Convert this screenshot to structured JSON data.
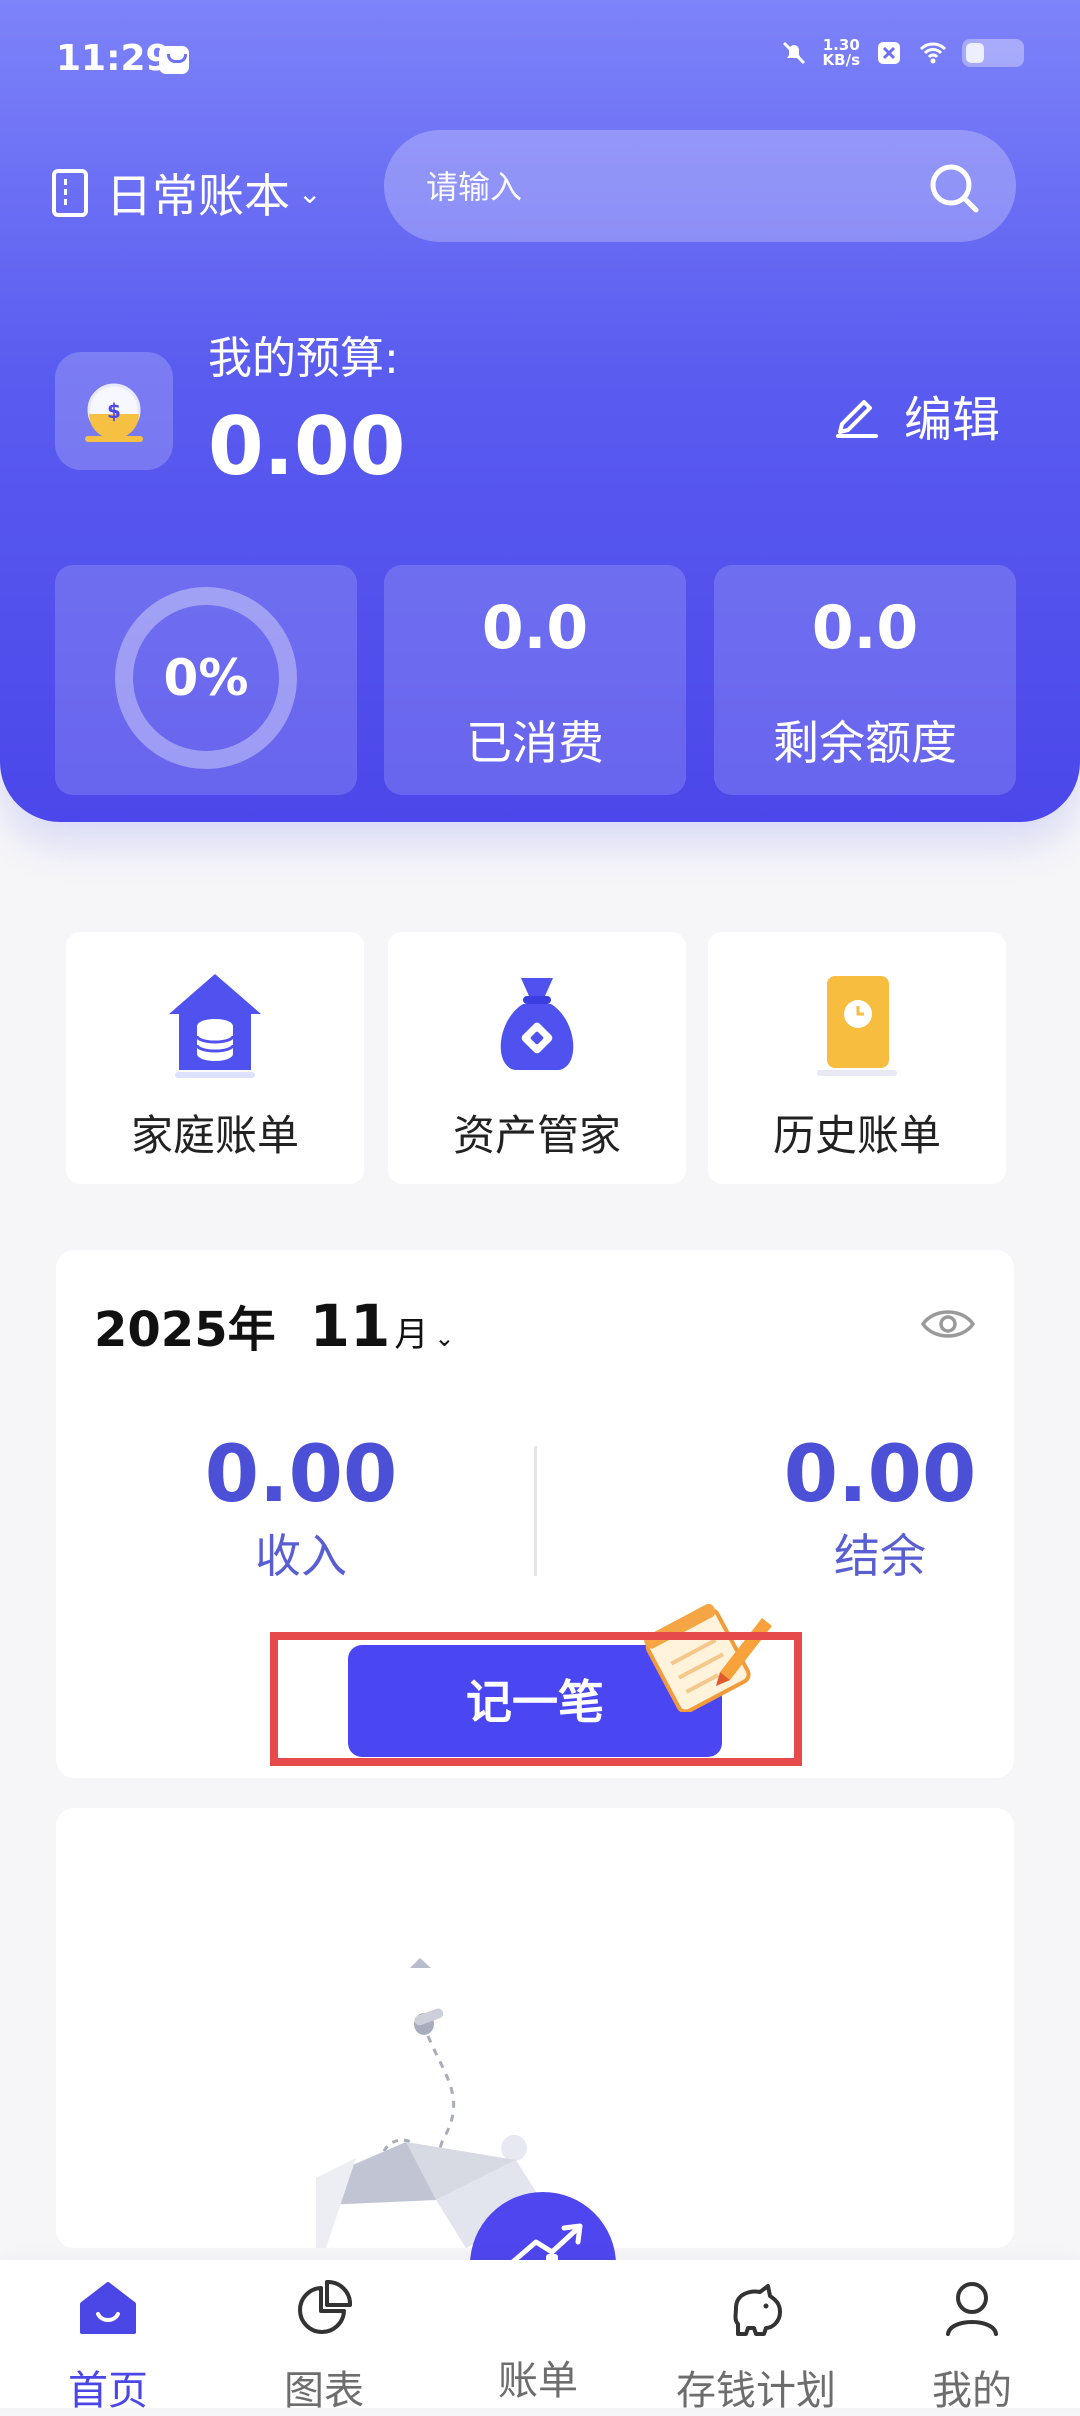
{
  "status_bar": {
    "time": "11:29",
    "net_speed_value": "1.30",
    "net_speed_unit": "KB/s"
  },
  "header": {
    "book_title": "日常账本",
    "search_placeholder": "请输入",
    "budget_label": "我的预算:",
    "budget_value": "0.00",
    "edit_label": "编辑",
    "progress_percent": "0%",
    "spent_value": "0.0",
    "spent_label": "已消费",
    "remaining_value": "0.0",
    "remaining_label": "剩余额度"
  },
  "shortcuts": [
    {
      "label": "家庭账单",
      "icon": "house-coins-icon"
    },
    {
      "label": "资产管家",
      "icon": "money-bag-icon"
    },
    {
      "label": "历史账单",
      "icon": "clock-card-icon"
    }
  ],
  "month_card": {
    "year": "2025年",
    "month": "11",
    "month_unit": "月",
    "income_value": "0.00",
    "income_label": "收入",
    "balance_value": "0.00",
    "balance_label": "结余",
    "record_button": "记一笔"
  },
  "tabs": [
    {
      "label": "首页",
      "icon": "home-icon",
      "active": true
    },
    {
      "label": "图表",
      "icon": "pie-chart-icon",
      "active": false
    },
    {
      "label": "账单",
      "icon": "bar-chart-up-icon",
      "active": false
    },
    {
      "label": "存钱计划",
      "icon": "piggy-bank-icon",
      "active": false
    },
    {
      "label": "我的",
      "icon": "user-icon",
      "active": false
    }
  ],
  "colors": {
    "accent": "#4a47f2",
    "highlight": "#e74a4a"
  }
}
